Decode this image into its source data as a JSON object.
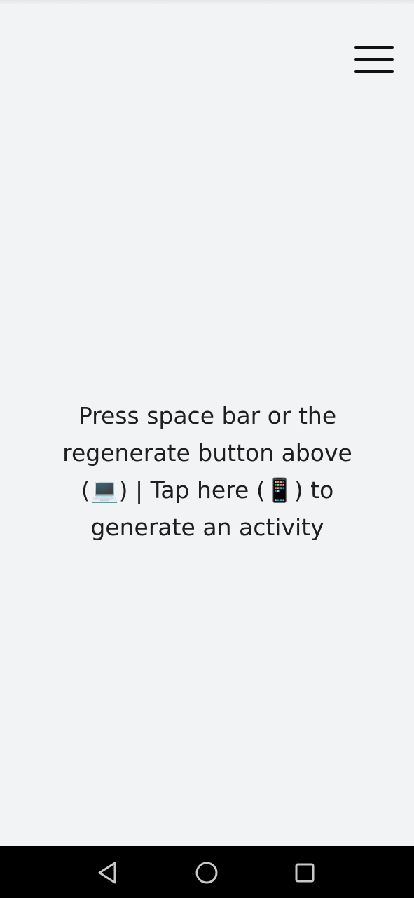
{
  "menu": {
    "icon": "hamburger-menu-icon"
  },
  "prompt": {
    "text": "Press space bar or the regenerate button above (💻) | Tap here (📱) to generate an activity"
  },
  "system_nav": {
    "back_icon": "back-triangle-icon",
    "home_icon": "home-circle-icon",
    "recents_icon": "recents-square-icon"
  },
  "colors": {
    "background": "#f2f3f5",
    "text": "#1f1f1f",
    "nav_bar": "#000000"
  }
}
